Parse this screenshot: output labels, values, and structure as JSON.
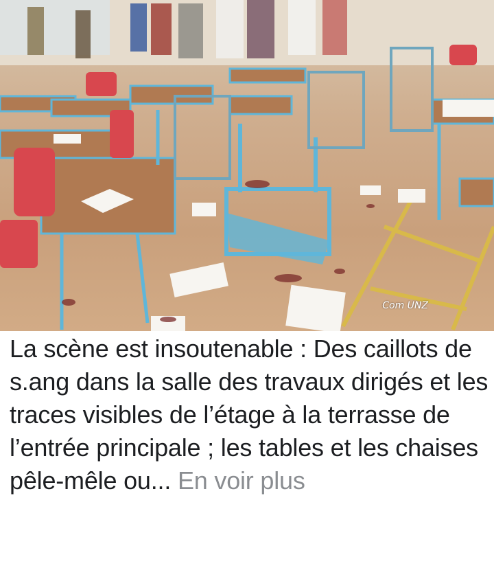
{
  "photo": {
    "alt": "",
    "watermark": "Com UNZ"
  },
  "post": {
    "text": "La scène est insoutenable : Des caillots de s.ang dans la salle des travaux dirigés et les traces visibles de l’étage à la terrasse de l’entrée principale ; les tables et les chaises pêle-mêle ou...",
    "see_more": "En voir plus"
  },
  "colors": {
    "text": "#1c1e21",
    "see_more": "#8a8d91",
    "desk_frame": "#5fb6d9",
    "desk_top": "#b07a52",
    "chair_seat": "#d8474e"
  }
}
